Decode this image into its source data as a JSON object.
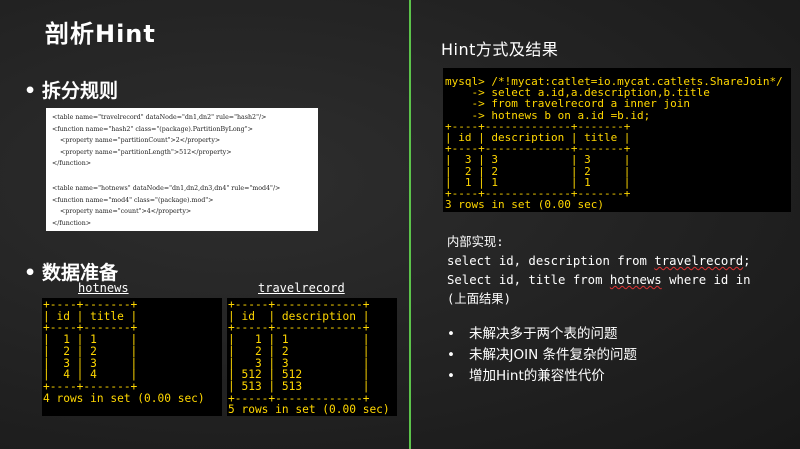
{
  "left": {
    "title": "剖析Hint",
    "bullet1": "拆分规则",
    "bullet2": "数据准备",
    "config_lines": [
      "<table name=\"travelrecord\" dataNode=\"dn1,dn2\" rule=\"hash2\"/>",
      "<function name=\"hash2\" class=\"(package).PartitionByLong\">",
      "    <property name=\"partitionCount\">2</property>",
      "    <property name=\"partitionLength\">512</property>",
      "</function>",
      "",
      "<table name=\"hotnews\" dataNode=\"dn1,dn2,dn3,dn4\" rule=\"mod4\"/>",
      "<function name=\"mod4\" class=\"(package).mod\">",
      "    <property name=\"count\">4</property>",
      "</function>"
    ],
    "hotnews_label": "hotnews",
    "travelrecord_label": "travelrecord",
    "hotnews_result": "+----+-------+\n| id | title |\n+----+-------+\n|  1 | 1     |\n|  2 | 2     |\n|  3 | 3     |\n|  4 | 4     |\n+----+-------+\n4 rows in set (0.00 sec)",
    "travelrecord_result": "+-----+-------------+\n| id  | description |\n+-----+-------------+\n|   1 | 1           |\n|   2 | 2           |\n|   3 | 3           |\n| 512 | 512         |\n| 513 | 513         |\n+-----+-------------+\n5 rows in set (0.00 sec)"
  },
  "right": {
    "title": "Hint方式及结果",
    "query": "mysql> /*!mycat:catlet=io.mycat.catlets.ShareJoin*/\n    -> select a.id,a.description,b.title\n    -> from travelrecord a inner join\n    -> hotnews b on a.id =b.id;\n+----+-------------+-------+\n| id | description | title |\n+----+-------------+-------+\n|  3 | 3           | 3     |\n|  2 | 2           | 2     |\n|  1 | 1           | 1     |\n+----+-------------+-------+\n3 rows in set (0.00 sec)",
    "impl_title": "内部实现:",
    "impl_line1_a": "select id, description from ",
    "impl_line1_b": "travelrecord",
    "impl_line1_c": ";",
    "impl_line2_a": "Select id, title from ",
    "impl_line2_b": "hotnews",
    "impl_line2_c": " where id in",
    "impl_line3": "(上面结果)",
    "issues": [
      "未解决多于两个表的问题",
      "未解决JOIN 条件复杂的问题",
      "增加Hint的兼容性代价"
    ]
  }
}
